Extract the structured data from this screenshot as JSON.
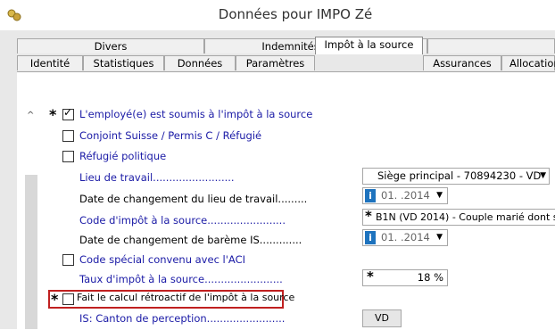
{
  "window": {
    "title": "Données pour IMPO Zé"
  },
  "tabs_row1": [
    {
      "label": "Divers"
    },
    {
      "label": "Indemnités spéciales"
    },
    {
      "label": ""
    }
  ],
  "tabs_row2": [
    {
      "label": "Identité"
    },
    {
      "label": "Statistiques"
    },
    {
      "label": "Données"
    },
    {
      "label": "Paramètres"
    },
    {
      "label": "Impôt à la source"
    },
    {
      "label": "Assurances"
    },
    {
      "label": "Allocation"
    }
  ],
  "form": {
    "soumis": {
      "label": "L'employé(e) est soumis à l'impôt à la source",
      "checked": true,
      "required_mark": "*"
    },
    "conjoint": {
      "label": "Conjoint Suisse / Permis C / Réfugié",
      "checked": false
    },
    "refugie": {
      "label": "Réfugié politique",
      "checked": false
    },
    "lieu_travail": {
      "label": "Lieu de travail.........................",
      "value": "Siège principal - 70894230 - VD"
    },
    "date_lieu": {
      "label": "Date de changement du lieu de travail.........",
      "value": "01.    .2014"
    },
    "code_impot": {
      "label": "Code d'impôt à la source........................",
      "value": "B1N (VD 2014) - Couple marié dont seul",
      "required_mark": "*"
    },
    "date_bareme": {
      "label": "Date de changement de barème IS.............",
      "value": "01.    .2014"
    },
    "code_special": {
      "label": "Code spécial convenu avec l'ACI",
      "checked": false
    },
    "taux": {
      "label": "Taux d'impôt à la source........................",
      "value": "18 %",
      "required_mark": "*"
    },
    "retro": {
      "label": "Fait le calcul rétroactif de l'impôt à la source",
      "checked": false,
      "required_mark": "*"
    },
    "canton": {
      "label": "IS: Canton de perception........................",
      "value": "VD"
    }
  },
  "icons": {
    "info": "i",
    "dropdown": "▼",
    "collapse": "^"
  }
}
